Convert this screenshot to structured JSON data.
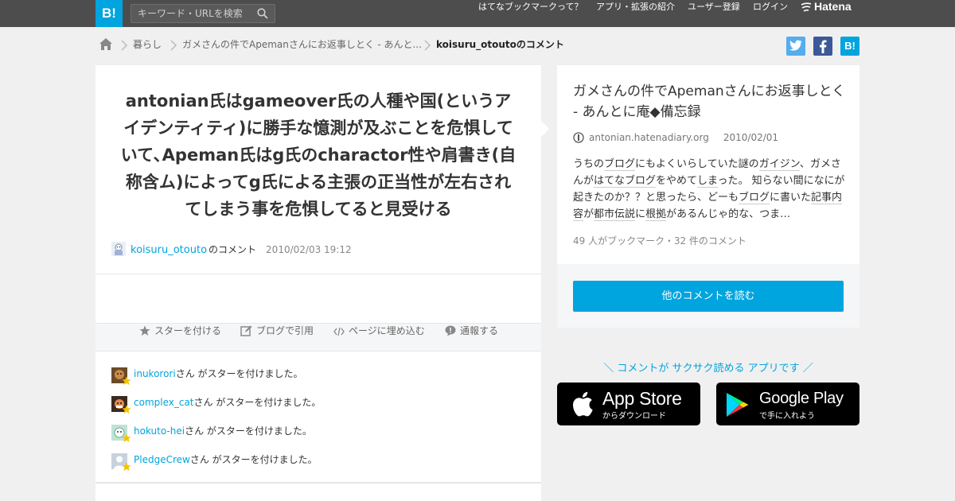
{
  "header": {
    "logo": "B!",
    "search_placeholder": "キーワード・URLを検索",
    "nav": [
      "はてなブックマークって？",
      "アプリ・拡張の紹介",
      "ユーザー登録",
      "ログイン"
    ],
    "brand": "Hatena"
  },
  "breadcrumb": {
    "home_icon": "home-icon",
    "items": [
      "暮らし",
      "ガメさんの件でApemanさんにお返事しとく - あんと...",
      "koisuru_otoutoのコメント"
    ]
  },
  "share": {
    "twitter_color": "#55acee",
    "facebook_color": "#3b5998",
    "hatena_color": "#00a4de",
    "hatena_label": "B!"
  },
  "comment": {
    "text": "antonian氏はgameover氏の人種や国(というアイデンティティ)に勝手な憶測が及ぶことを危惧していて､Apeman氏はg氏のcharactor性や肩書き(自称含ム)によってg氏による主張の正当性が左右されてしまう事を危惧してると見受ける",
    "user": "koisuru_otouto",
    "user_suffix": "のコメント",
    "date": "2010/02/03 19:12"
  },
  "actions": [
    "スターを付ける",
    "ブログで引用",
    "ページに埋め込む",
    "通報する"
  ],
  "stars": [
    {
      "user": "inukorori",
      "suffix": "さん がスターを付けました。"
    },
    {
      "user": "complex_cat",
      "suffix": "さん がスターを付けました。"
    },
    {
      "user": "hokuto-hei",
      "suffix": "さん がスターを付けました。"
    },
    {
      "user": "PledgeCrew",
      "suffix": "さん がスターを付けました。"
    }
  ],
  "entry": {
    "title": "ガメさんの件でApemanさんにお返事しとく - あんとに庵◆備忘録",
    "domain": "antonian.hatenadiary.org",
    "date": "2010/02/01",
    "summary_parts": [
      {
        "t": "うちの",
        "link": false
      },
      {
        "t": "ブログ",
        "link": true
      },
      {
        "t": "にもよくいらしていた謎の",
        "link": false
      },
      {
        "t": "ガイジン",
        "link": true
      },
      {
        "t": "、ガメさんが",
        "link": false
      },
      {
        "t": "はてなブログ",
        "link": true
      },
      {
        "t": "をやめて",
        "link": false
      },
      {
        "t": "しま",
        "link": true
      },
      {
        "t": "った。 知らない間になにが起きたのか？？と思ったら、どーも",
        "link": false
      },
      {
        "t": "ブログ",
        "link": true
      },
      {
        "t": "に書いた",
        "link": false
      },
      {
        "t": "記事内容",
        "link": true
      },
      {
        "t": "が",
        "link": false
      },
      {
        "t": "都市伝説",
        "link": true
      },
      {
        "t": "に",
        "link": false
      },
      {
        "t": "根拠",
        "link": true
      },
      {
        "t": "があるんじゃ的な、つま…",
        "link": false
      }
    ],
    "counts": "49 人がブックマーク・32 件のコメント",
    "read_button": "他のコメントを読む"
  },
  "app_promo": {
    "headline": "＼ コメントが サクサク読める アプリです ／",
    "app_store_big": "App Store",
    "app_store_small": "からダウンロード",
    "google_play_big": "Google Play",
    "google_play_small": "で手に入れよう"
  },
  "colors": {
    "accent": "#00a4de",
    "topbar": "#4d4d4d",
    "star": "#f5c400"
  }
}
